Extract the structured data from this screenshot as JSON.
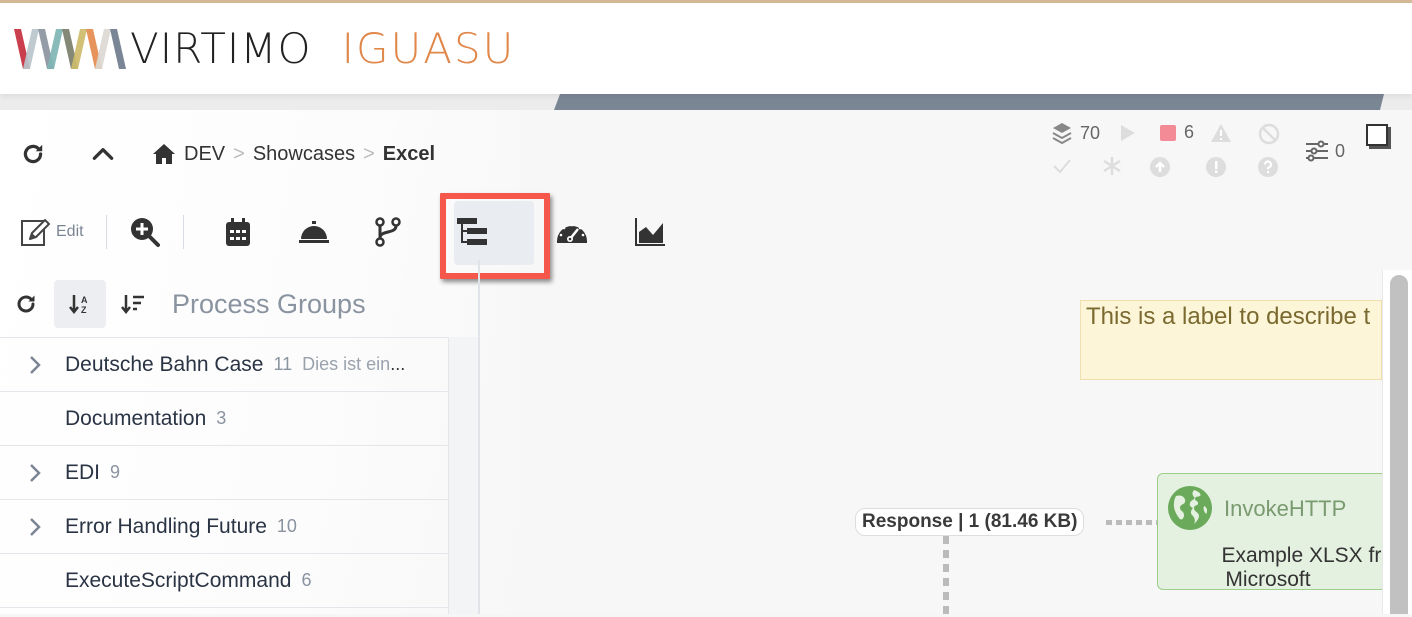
{
  "header": {
    "brand": "VIRTIMO",
    "product": "IGUASU",
    "logo_icon": "virtimo-logo-icon",
    "logo_colors": [
      "#c62f3e",
      "#b9c6cc",
      "#8b95a0",
      "#7fb5b5",
      "#7a7e6a",
      "#cdbb6a",
      "#e58a4e",
      "#dcd8d2",
      "#6f7b8c"
    ]
  },
  "nav": {
    "refresh_icon": "refresh-icon",
    "up_icon": "chevron-up-icon",
    "home_icon": "home-icon",
    "breadcrumb": [
      "DEV",
      "Showcases",
      "Excel"
    ]
  },
  "toolbar": {
    "edit_label": "Edit",
    "items": [
      "edit-icon",
      "zoom-in-icon",
      "calendar-icon",
      "service-bell-icon",
      "branch-icon",
      "hierarchy-icon",
      "gauge-icon",
      "area-chart-icon"
    ],
    "highlight_color": "#f5574a"
  },
  "status": {
    "total_count": "70",
    "stopped_count": "6",
    "parameters_count": "0",
    "stopped_color": "#f28b96"
  },
  "process_groups": {
    "title": "Process Groups",
    "items": [
      {
        "name": "Deutsche Bahn Case",
        "count": "11",
        "description": "Dies ist ein",
        "ellipsis": "...",
        "expandable": true
      },
      {
        "name": "Documentation",
        "count": "3",
        "description": "",
        "ellipsis": "",
        "expandable": false
      },
      {
        "name": "EDI",
        "count": "9",
        "description": "",
        "ellipsis": "",
        "expandable": true
      },
      {
        "name": "Error Handling Future",
        "count": "10",
        "description": "",
        "ellipsis": "",
        "expandable": true
      },
      {
        "name": "ExecuteScriptCommand",
        "count": "6",
        "description": "",
        "ellipsis": "",
        "expandable": false
      }
    ]
  },
  "canvas": {
    "label_text": "This is a label to describe t",
    "connection_label": "Response | 1 (81.46 KB)",
    "processor": {
      "type": "InvokeHTTP",
      "name_line1": "Example XLSX from",
      "name_line2": "Microsoft",
      "icon": "globe-icon"
    }
  }
}
